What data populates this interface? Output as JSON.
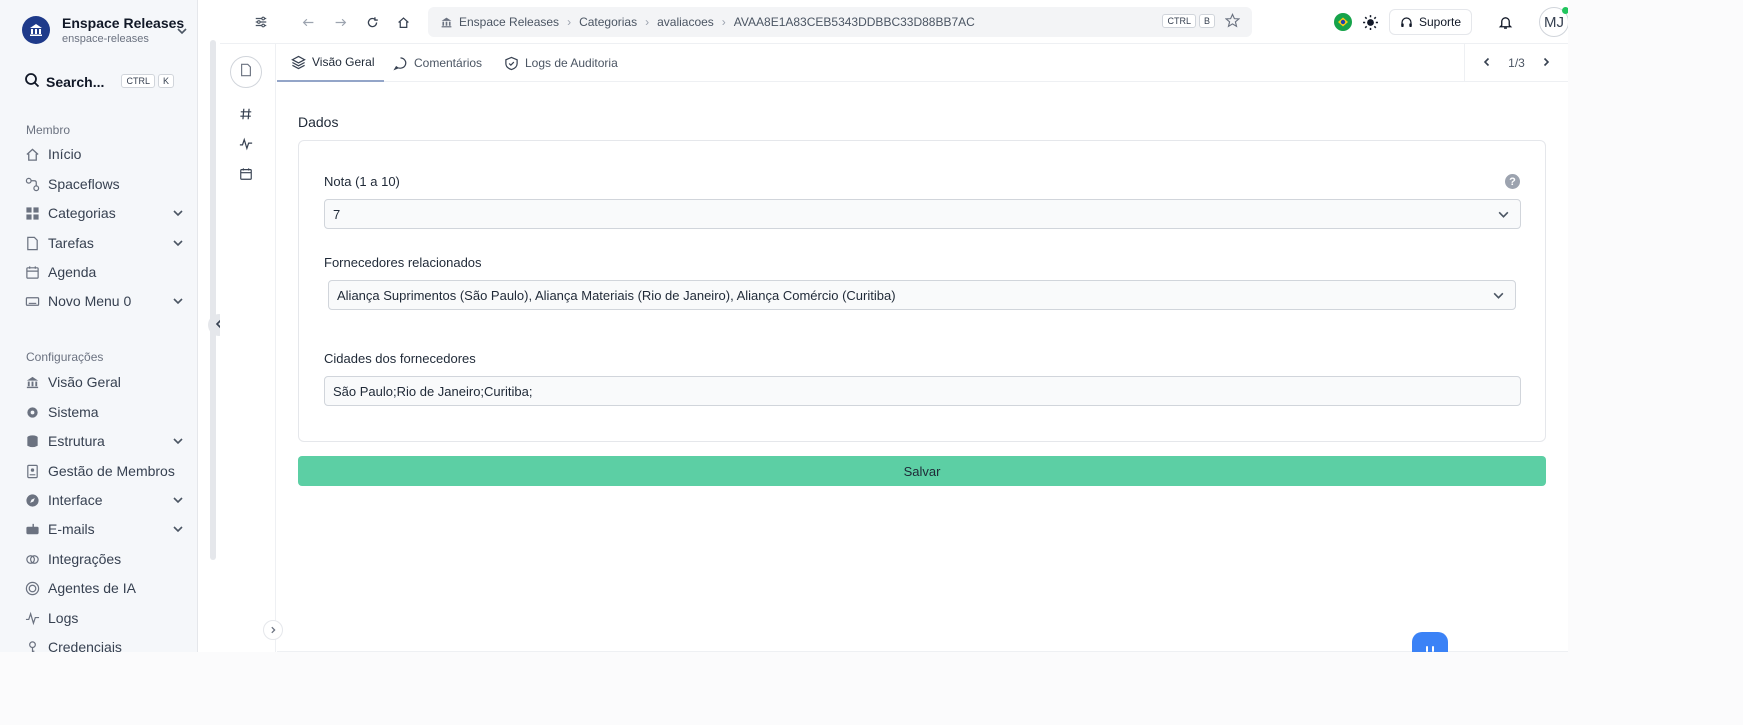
{
  "workspace": {
    "name": "Enspace Releases",
    "slug": "enspace-releases"
  },
  "search": {
    "label": "Search...",
    "kbd1": "CTRL",
    "kbd2": "K"
  },
  "sidebar": {
    "section_member": "Membro",
    "member_items": [
      {
        "label": "Início",
        "icon": "home-icon"
      },
      {
        "label": "Spaceflows",
        "icon": "flow-icon"
      },
      {
        "label": "Categorias",
        "icon": "grid-icon"
      },
      {
        "label": "Tarefas",
        "icon": "file-icon"
      },
      {
        "label": "Agenda",
        "icon": "calendar-icon"
      },
      {
        "label": "Novo Menu 0",
        "icon": "keyboard-icon"
      }
    ],
    "section_config": "Configurações",
    "config_items": [
      {
        "label": "Visão Geral",
        "icon": "building-icon"
      },
      {
        "label": "Sistema",
        "icon": "gear-icon"
      },
      {
        "label": "Estrutura",
        "icon": "database-icon"
      },
      {
        "label": "Gestão de Membros",
        "icon": "id-card-icon"
      },
      {
        "label": "Interface",
        "icon": "compass-icon"
      },
      {
        "label": "E-mails",
        "icon": "mailbox-icon"
      },
      {
        "label": "Integrações",
        "icon": "link-icon"
      },
      {
        "label": "Agentes de IA",
        "icon": "ai-icon"
      },
      {
        "label": "Logs",
        "icon": "pulse-icon"
      },
      {
        "label": "Credenciais",
        "icon": "key-icon"
      }
    ]
  },
  "breadcrumb": {
    "items": [
      "Enspace Releases",
      "Categorias",
      "avaliacoes",
      "AVAA8E1A83CEB5343DDBBC33D88BB7AC"
    ],
    "kbd1": "CTRL",
    "kbd2": "B"
  },
  "header": {
    "support_label": "Suporte",
    "avatar_initials": "MJ"
  },
  "tabs": [
    {
      "label": "Visão Geral"
    },
    {
      "label": "Comentários"
    },
    {
      "label": "Logs de Auditoria"
    }
  ],
  "pager": {
    "text": "1/3"
  },
  "form": {
    "section_title": "Dados",
    "rating_label": "Nota (1 a 10)",
    "rating_value": "7",
    "suppliers_label": "Fornecedores relacionados",
    "suppliers_value": "Aliança Suprimentos (São Paulo), Aliança Materiais (Rio de Janeiro), Aliança Comércio (Curitiba)",
    "cities_label": "Cidades dos fornecedores",
    "cities_value": "São Paulo;Rio de Janeiro;Curitiba;",
    "help_glyph": "?",
    "save_label": "Salvar"
  },
  "colors": {
    "save": "#5ccfa4",
    "brand": "#1e3a8a",
    "online": "#22c55e"
  }
}
